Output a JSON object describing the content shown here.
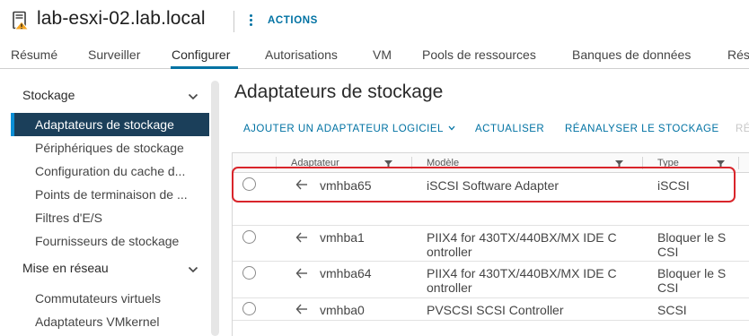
{
  "header": {
    "host_name": "lab-esxi-02.lab.local",
    "actions_label": "ACTIONS",
    "host_icon": "host-warning-icon",
    "accent_color": "#0072a3",
    "warning_color": "#f5a623"
  },
  "tabs": [
    {
      "label": "Résumé",
      "active": false
    },
    {
      "label": "Surveiller",
      "active": false
    },
    {
      "label": "Configurer",
      "active": true
    },
    {
      "label": "Autorisations",
      "active": false
    },
    {
      "label": "VM",
      "active": false
    },
    {
      "label": "Pools de ressources",
      "active": false
    },
    {
      "label": "Banques de données",
      "active": false
    },
    {
      "label": "Rés",
      "active": false
    }
  ],
  "sidebar": {
    "sections": [
      {
        "title": "Stockage",
        "expanded": true
      },
      {
        "title": "Mise en réseau",
        "expanded": true
      }
    ],
    "items": [
      {
        "label": "Adaptateurs de stockage",
        "active": true
      },
      {
        "label": "Périphériques de stockage",
        "active": false
      },
      {
        "label": "Configuration du cache d...",
        "active": false
      },
      {
        "label": "Points de terminaison de ...",
        "active": false
      },
      {
        "label": "Filtres d'E/S",
        "active": false
      },
      {
        "label": "Fournisseurs de stockage",
        "active": false
      },
      {
        "label": "Commutateurs virtuels",
        "active": false
      },
      {
        "label": "Adaptateurs VMkernel",
        "active": false
      }
    ]
  },
  "main": {
    "title": "Adaptateurs de stockage",
    "toolbar": {
      "add_label": "AJOUTER UN ADAPTATEUR LOGICIEL",
      "refresh_label": "ACTUALISER",
      "rescan_label": "RÉANALYSER LE STOCKAGE",
      "more_label": "RÉ"
    },
    "columns": [
      "Adaptateur",
      "Modèle",
      "Type"
    ],
    "rows": [
      {
        "adapter": "vmhba65",
        "model": "iSCSI Software Adapter",
        "type": "iSCSI"
      },
      {
        "adapter": "vmhba1",
        "model": "PIIX4 for 430TX/440BX/MX IDE C ontroller",
        "type": "Bloquer le S CSI"
      },
      {
        "adapter": "vmhba64",
        "model": "PIIX4 for 430TX/440BX/MX IDE C ontroller",
        "type": "Bloquer le S CSI"
      },
      {
        "adapter": "vmhba0",
        "model": "PVSCSI SCSI Controller",
        "type": "SCSI"
      }
    ],
    "highlight_color": "#d9252b"
  }
}
